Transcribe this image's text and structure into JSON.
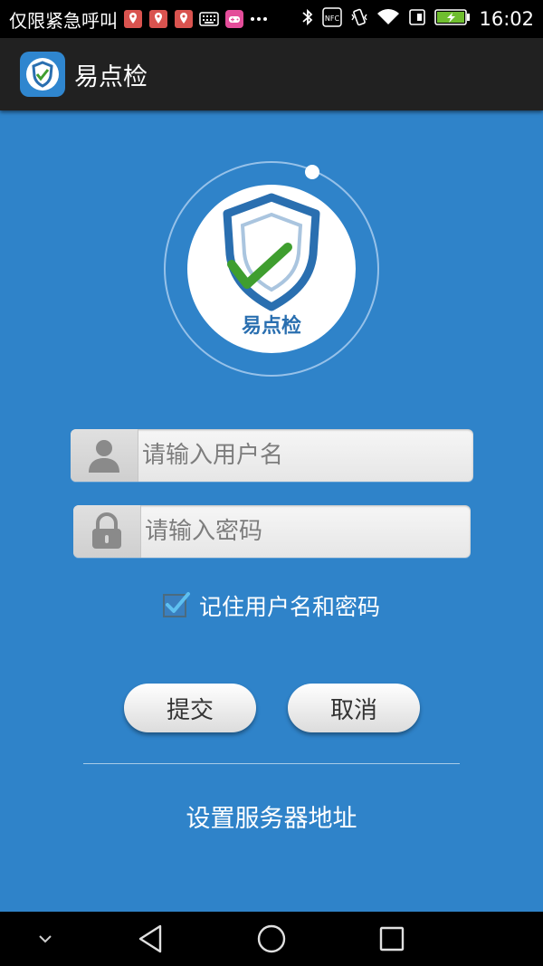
{
  "status_bar": {
    "carrier": "仅限紧急呼叫",
    "nfc_label": "NFC",
    "time": "16:02"
  },
  "app_bar": {
    "title": "易点检"
  },
  "logo": {
    "text": "易点检",
    "icon": "shield-check-logo"
  },
  "form": {
    "username_placeholder": "请输入用户名",
    "password_placeholder": "请输入密码",
    "remember_label": "记住用户名和密码",
    "remember_checked": true
  },
  "buttons": {
    "submit_label": "提交",
    "cancel_label": "取消"
  },
  "links": {
    "server_settings": "设置服务器地址"
  },
  "colors": {
    "background": "#2f83c9",
    "app_bar": "#212121",
    "shield_blue": "#2a6fb0",
    "check_green": "#3f9e2f"
  }
}
